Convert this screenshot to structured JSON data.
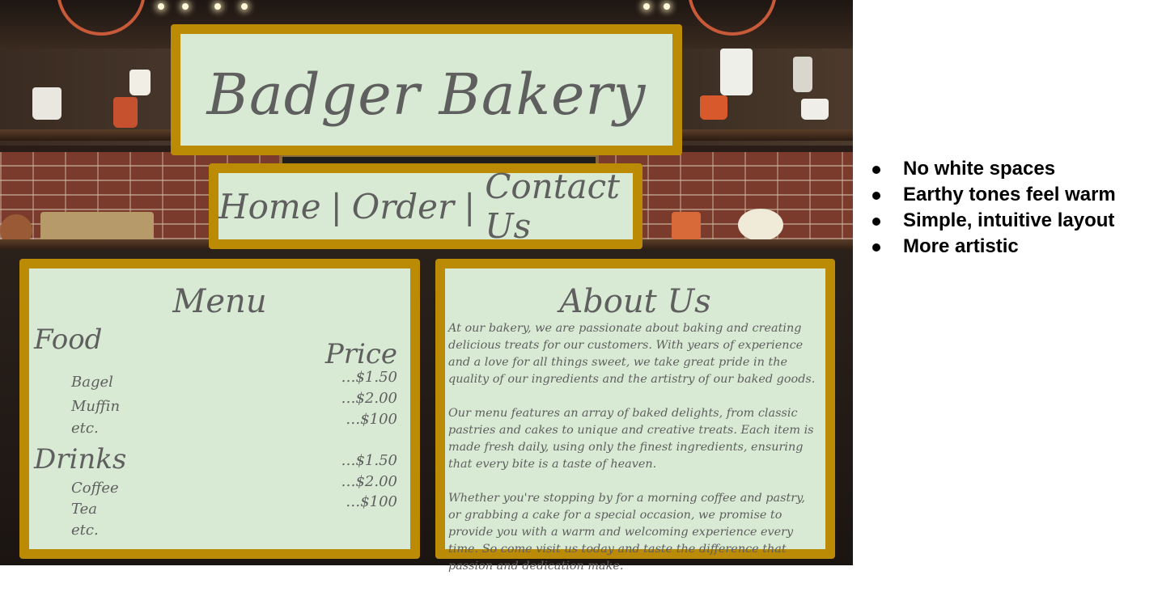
{
  "colors": {
    "panel_bg": "#d8ead4",
    "panel_border": "#bb8b06",
    "panel_text": "#5f5f5f",
    "notes_text": "#000000"
  },
  "header": {
    "title": "Badger Bakery"
  },
  "nav": {
    "items": [
      {
        "label": "Home"
      },
      {
        "label": "Order"
      },
      {
        "label": "Contact Us"
      }
    ],
    "separator": "|"
  },
  "menu": {
    "heading": "Menu",
    "price_heading": "Price",
    "food": {
      "title": "Food",
      "items": [
        {
          "name": "Bagel",
          "price": "…$1.50"
        },
        {
          "name": "Muffin",
          "price": "…$2.00"
        },
        {
          "name": "etc.",
          "price": "…$100"
        }
      ]
    },
    "drinks": {
      "title": "Drinks",
      "items": [
        {
          "name": "Coffee",
          "price": "…$1.50"
        },
        {
          "name": "Tea",
          "price": "…$2.00"
        },
        {
          "name": "etc.",
          "price": "…$100"
        }
      ]
    }
  },
  "about": {
    "heading": "About Us",
    "paragraphs": [
      "At our bakery, we are passionate about baking and creating delicious treats for our customers. With years of experience and a love for all things sweet, we take great pride in the quality of our ingredients and the artistry of our baked goods.",
      "Our menu features an array of baked delights, from classic pastries and cakes to unique and creative treats. Each item is made fresh daily, using only the finest ingredients, ensuring that every bite is a taste of heaven.",
      "Whether you're stopping by for a morning coffee and pastry, or grabbing a cake for a special occasion, we promise to provide you with a warm and welcoming experience every time. So come visit us today and taste the difference that passion and dedication make."
    ]
  },
  "notes": [
    "No white spaces",
    "Earthy tones feel warm",
    "Simple, intuitive layout",
    "More artistic"
  ]
}
